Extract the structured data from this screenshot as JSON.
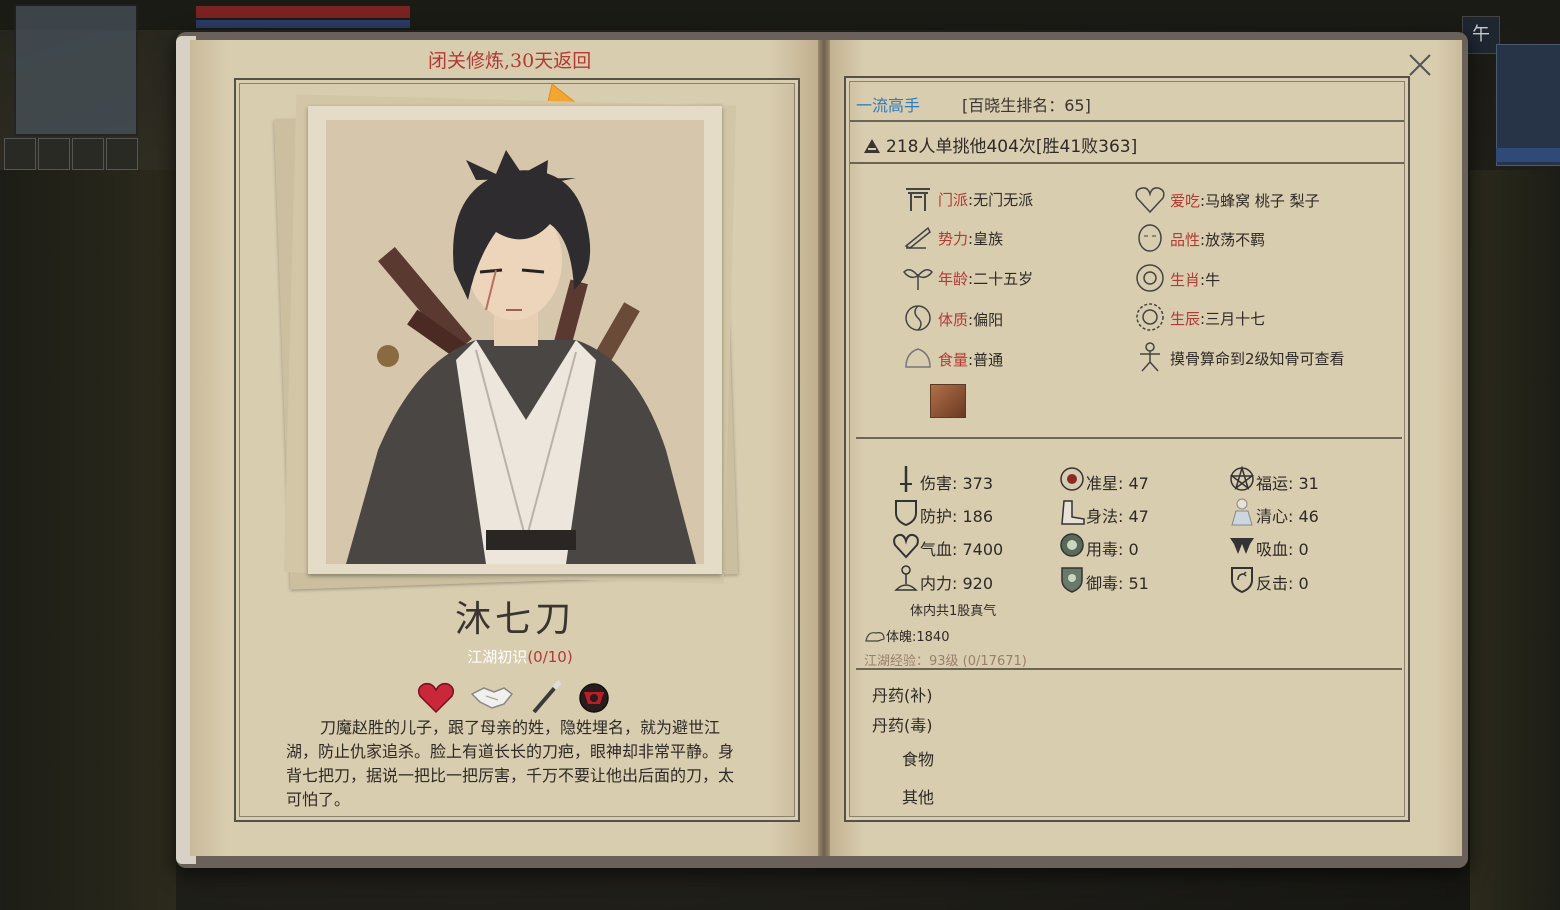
{
  "top_right_char": "午",
  "retreat_notice": "闭关修炼,30天返回",
  "character": {
    "name": "沐七刀",
    "reputation_label": "江湖初识",
    "reputation_value": "(0/10)",
    "relation_icons": [
      "heart-icon",
      "handshake-icon",
      "brush-icon",
      "enemy-mask-icon"
    ],
    "bio": "刀魔赵胜的儿子，跟了母亲的姓，隐姓埋名，就为避世江湖，防止仇家追杀。脸上有道长长的刀疤，眼神却非常平静。身背七把刀，据说一把比一把厉害，千万不要让他出后面的刀，太可怕了。"
  },
  "rank": {
    "title": "一流高手",
    "ranking": "[百晓生排名：65]"
  },
  "challenge": "218人单挑他404次[胜41败363]",
  "info": {
    "sect_label": "门派",
    "sect_value": ":无门无派",
    "faction_label": "势力",
    "faction_value": ":皇族",
    "age_label": "年龄",
    "age_value": ":二十五岁",
    "constitution_label": "体质",
    "constitution_value": ":偏阳",
    "appetite_label": "食量",
    "appetite_value": ":普通",
    "likes_label": "爱吃",
    "likes_value": ":马蜂窝 桃子 梨子",
    "character_label": "品性",
    "character_value": ":放荡不羁",
    "zodiac_label": "生肖",
    "zodiac_value": ":牛",
    "birthday_label": "生辰",
    "birthday_value": ":三月十七",
    "bone_hint": "摸骨算命到2级知骨可查看"
  },
  "stats": {
    "damage": "伤害: 373",
    "accuracy": "准星: 47",
    "luck": "福运: 31",
    "defense": "防护: 186",
    "agility": "身法: 47",
    "clarity": "清心: 46",
    "hp": "气血: 7400",
    "poison_use": "用毒: 0",
    "lifesteal": "吸血: 0",
    "inner_power": "内力: 920",
    "poison_resist": "御毒: 51",
    "counter": "反击: 0"
  },
  "qi_text": "体内共1股真气",
  "physique": "体魄:1840",
  "experience": "江湖经验：93级 (0/17671)",
  "items": {
    "pill_tonic": "丹药(补)",
    "pill_poison": "丹药(毒)",
    "food": "食物",
    "other": "其他"
  }
}
